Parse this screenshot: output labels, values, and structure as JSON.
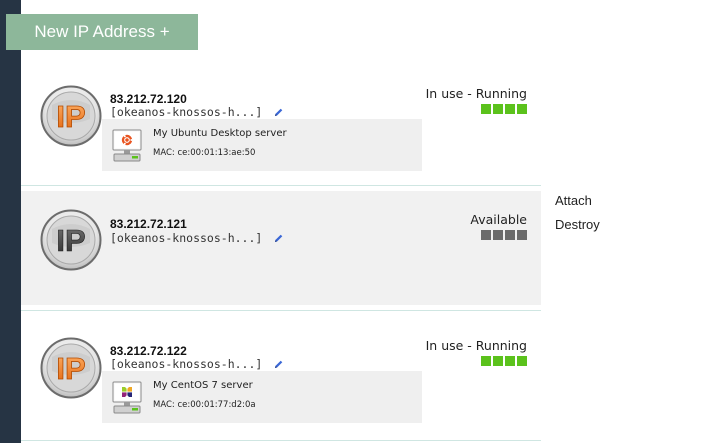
{
  "toolbar": {
    "new_ip_label": "New IP Address +"
  },
  "colors": {
    "rail": "#263444",
    "button": "#8db79a",
    "running": "#5bc21c",
    "idle": "#6b6b6b",
    "divider": "#cfe6e2"
  },
  "ips": [
    {
      "address": "83.212.72.120",
      "tag": "[okeanos-knossos-h...]",
      "status": "In use - Running",
      "status_color": "#5bc21c",
      "vm": {
        "name": "My Ubuntu Desktop server",
        "mac": "MAC: ce:00:01:13:ae:50",
        "os_icon": "ubuntu-logo-icon"
      },
      "badge_icon": "ip-badge-orange-icon"
    },
    {
      "address": "83.212.72.121",
      "tag": "[okeanos-knossos-h...]",
      "status": "Available",
      "status_color": "#6b6b6b",
      "badge_icon": "ip-badge-grey-icon"
    },
    {
      "address": "83.212.72.122",
      "tag": "[okeanos-knossos-h...]",
      "status": "In use - Running",
      "status_color": "#5bc21c",
      "vm": {
        "name": "My CentOS 7 server",
        "mac": "MAC: ce:00:01:77:d2:0a",
        "os_icon": "centos-logo-icon"
      },
      "badge_icon": "ip-badge-orange-icon"
    }
  ],
  "actions": {
    "attach_label": "Attach",
    "destroy_label": "Destroy"
  }
}
